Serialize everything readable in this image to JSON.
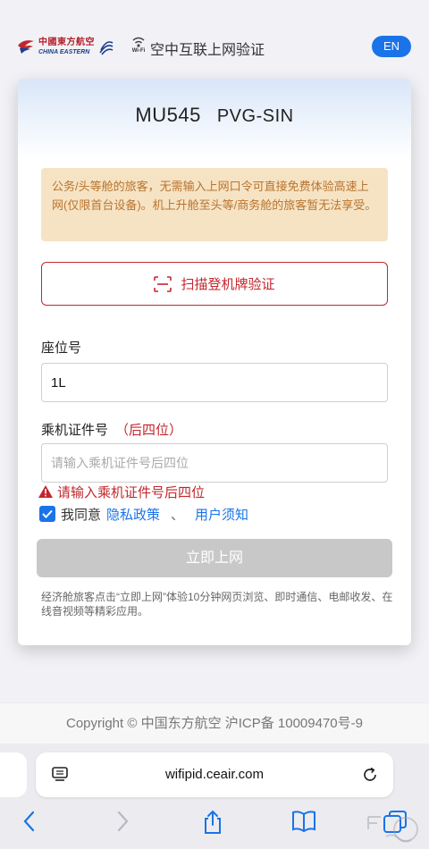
{
  "header": {
    "logo_cn": "中國東方航空",
    "logo_en": "CHINA EASTERN",
    "wifi_label": "Wi-Fi",
    "portal_title": "空中互联上网验证",
    "lang_button": "EN"
  },
  "card": {
    "flight_number": "MU545",
    "route": "PVG-SIN",
    "notice": "公务/头等舱的旅客，无需输入上网口令可直接免费体验高速上网(仅限首台设备)。机上升舱至头等/商务舱的旅客暂无法享受。",
    "scan_button": "扫描登机牌验证",
    "seat_label": "座位号",
    "seat_value": "1L",
    "id_label": "乘机证件号",
    "id_hint": "（后四位）",
    "id_placeholder": "请输入乘机证件号后四位",
    "error_text": "请输入乘机证件号后四位",
    "agree_text": "我同意",
    "privacy_link": "隐私政策",
    "separator": "、",
    "terms_link": "用户须知",
    "connect_button": "立即上网",
    "footnote": "经济舱旅客点击“立即上网”体验10分钟网页浏览、即时通信、电邮收发、在线音视频等精彩应用。"
  },
  "footer": {
    "copyright": "Copyright © 中国东方航空 沪ICP备 10009470号-9"
  },
  "browser": {
    "url": "wifipid.ceair.com"
  },
  "colors": {
    "accent_blue": "#1a73e8",
    "brand_red": "#c2272d",
    "notice_bg": "#f6e3c4",
    "notice_text": "#b9742e",
    "disabled_button": "#c8c8c8"
  }
}
